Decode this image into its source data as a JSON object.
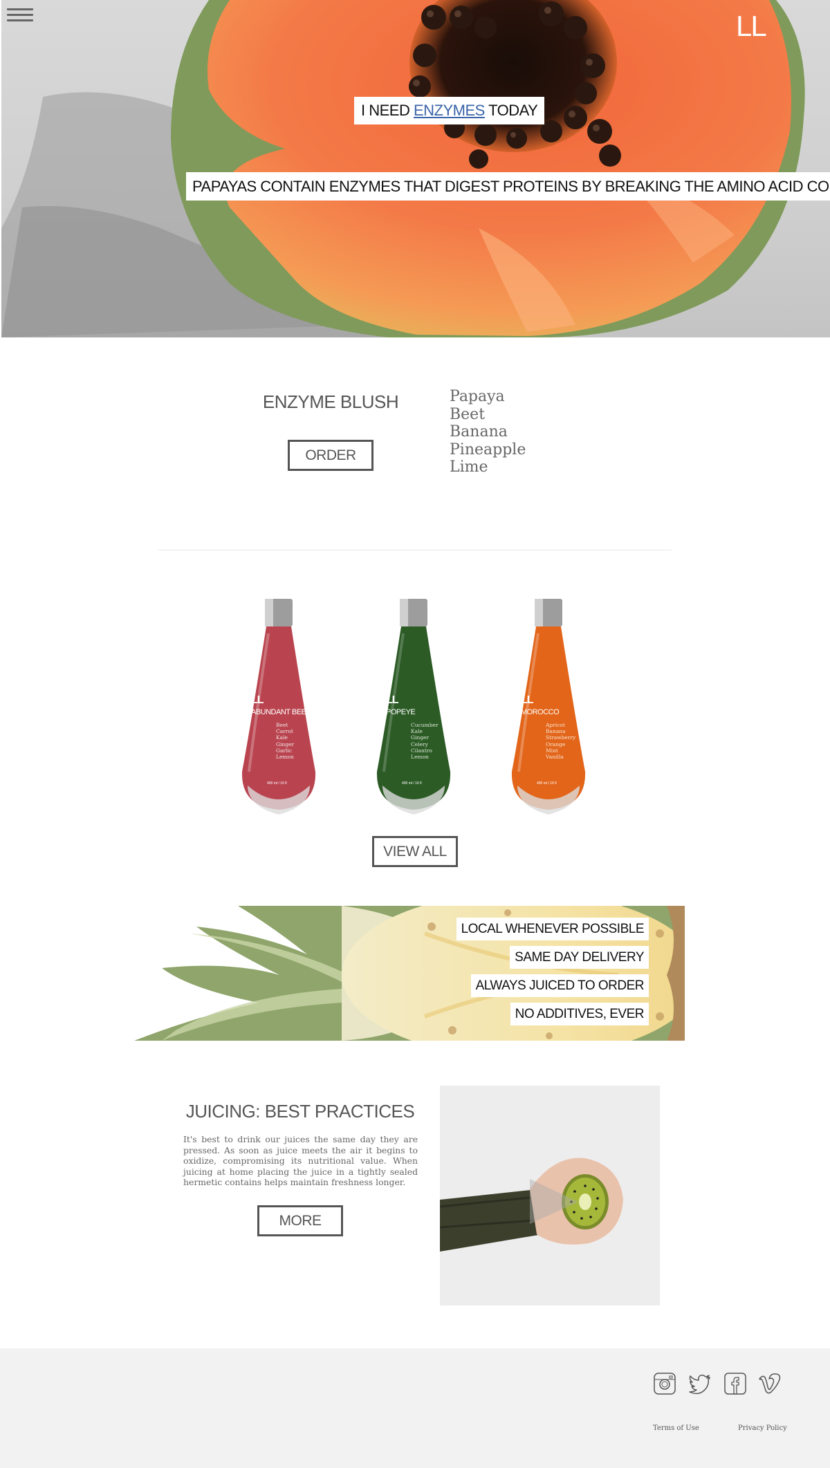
{
  "header": {
    "menu_icon": "hamburger-menu-icon",
    "logo": "LL"
  },
  "hero": {
    "tag_prefix": "I NEED",
    "tag_link": "ENZYMES",
    "tag_suffix": "TODAY",
    "subtitle": "PAPAYAS CONTAIN ENZYMES THAT DIGEST PROTEINS BY BREAKING THE AMINO ACID CONTENT."
  },
  "featured": {
    "name": "ENZYME BLUSH",
    "order_label": "ORDER",
    "ingredients": [
      "Papaya",
      "Beet",
      "Banana",
      "Pineapple",
      "Lime"
    ]
  },
  "products": {
    "view_all_label": "VIEW ALL",
    "bottles": [
      {
        "logo": "LL",
        "name": "ABUNDANT BEET",
        "color": "#b9444f",
        "ingredients": [
          "Beet",
          "Carrot",
          "Kale",
          "Ginger",
          "Garlic",
          "Lemon"
        ],
        "volume": "400 ml / 16 fl"
      },
      {
        "logo": "LL",
        "name": "POPEYE",
        "color": "#2c5b26",
        "ingredients": [
          "Cucumber",
          "Kale",
          "Ginger",
          "Celery",
          "Cilantro",
          "Lemon"
        ],
        "volume": "400 ml / 16 fl"
      },
      {
        "logo": "LL",
        "name": "MOROCCO",
        "color": "#e2651a",
        "ingredients": [
          "Apricot",
          "Banana",
          "Strawberry",
          "Orange",
          "Mint",
          "Vanilla"
        ],
        "volume": "400 ml / 16 fl"
      }
    ]
  },
  "perks": [
    "LOCAL WHENEVER POSSIBLE",
    "SAME DAY DELIVERY",
    "ALWAYS JUICED TO ORDER",
    "NO ADDITIVES, EVER"
  ],
  "best_practices": {
    "title": "JUICING: BEST PRACTICES",
    "text": "It's best to drink our juices the same day they are pressed. As soon as juice meets the air it begins to oxidize, compromising its nutritional value. When juicing at home placing the juice in a tightly sealed hermetic contains helps maintain freshness longer.",
    "more_label": "MORE"
  },
  "footer": {
    "social_icons": [
      "instagram-icon",
      "twitter-icon",
      "facebook-icon",
      "vimeo-icon"
    ],
    "terms_label": "Terms of Use",
    "privacy_label": "Privacy Policy"
  }
}
